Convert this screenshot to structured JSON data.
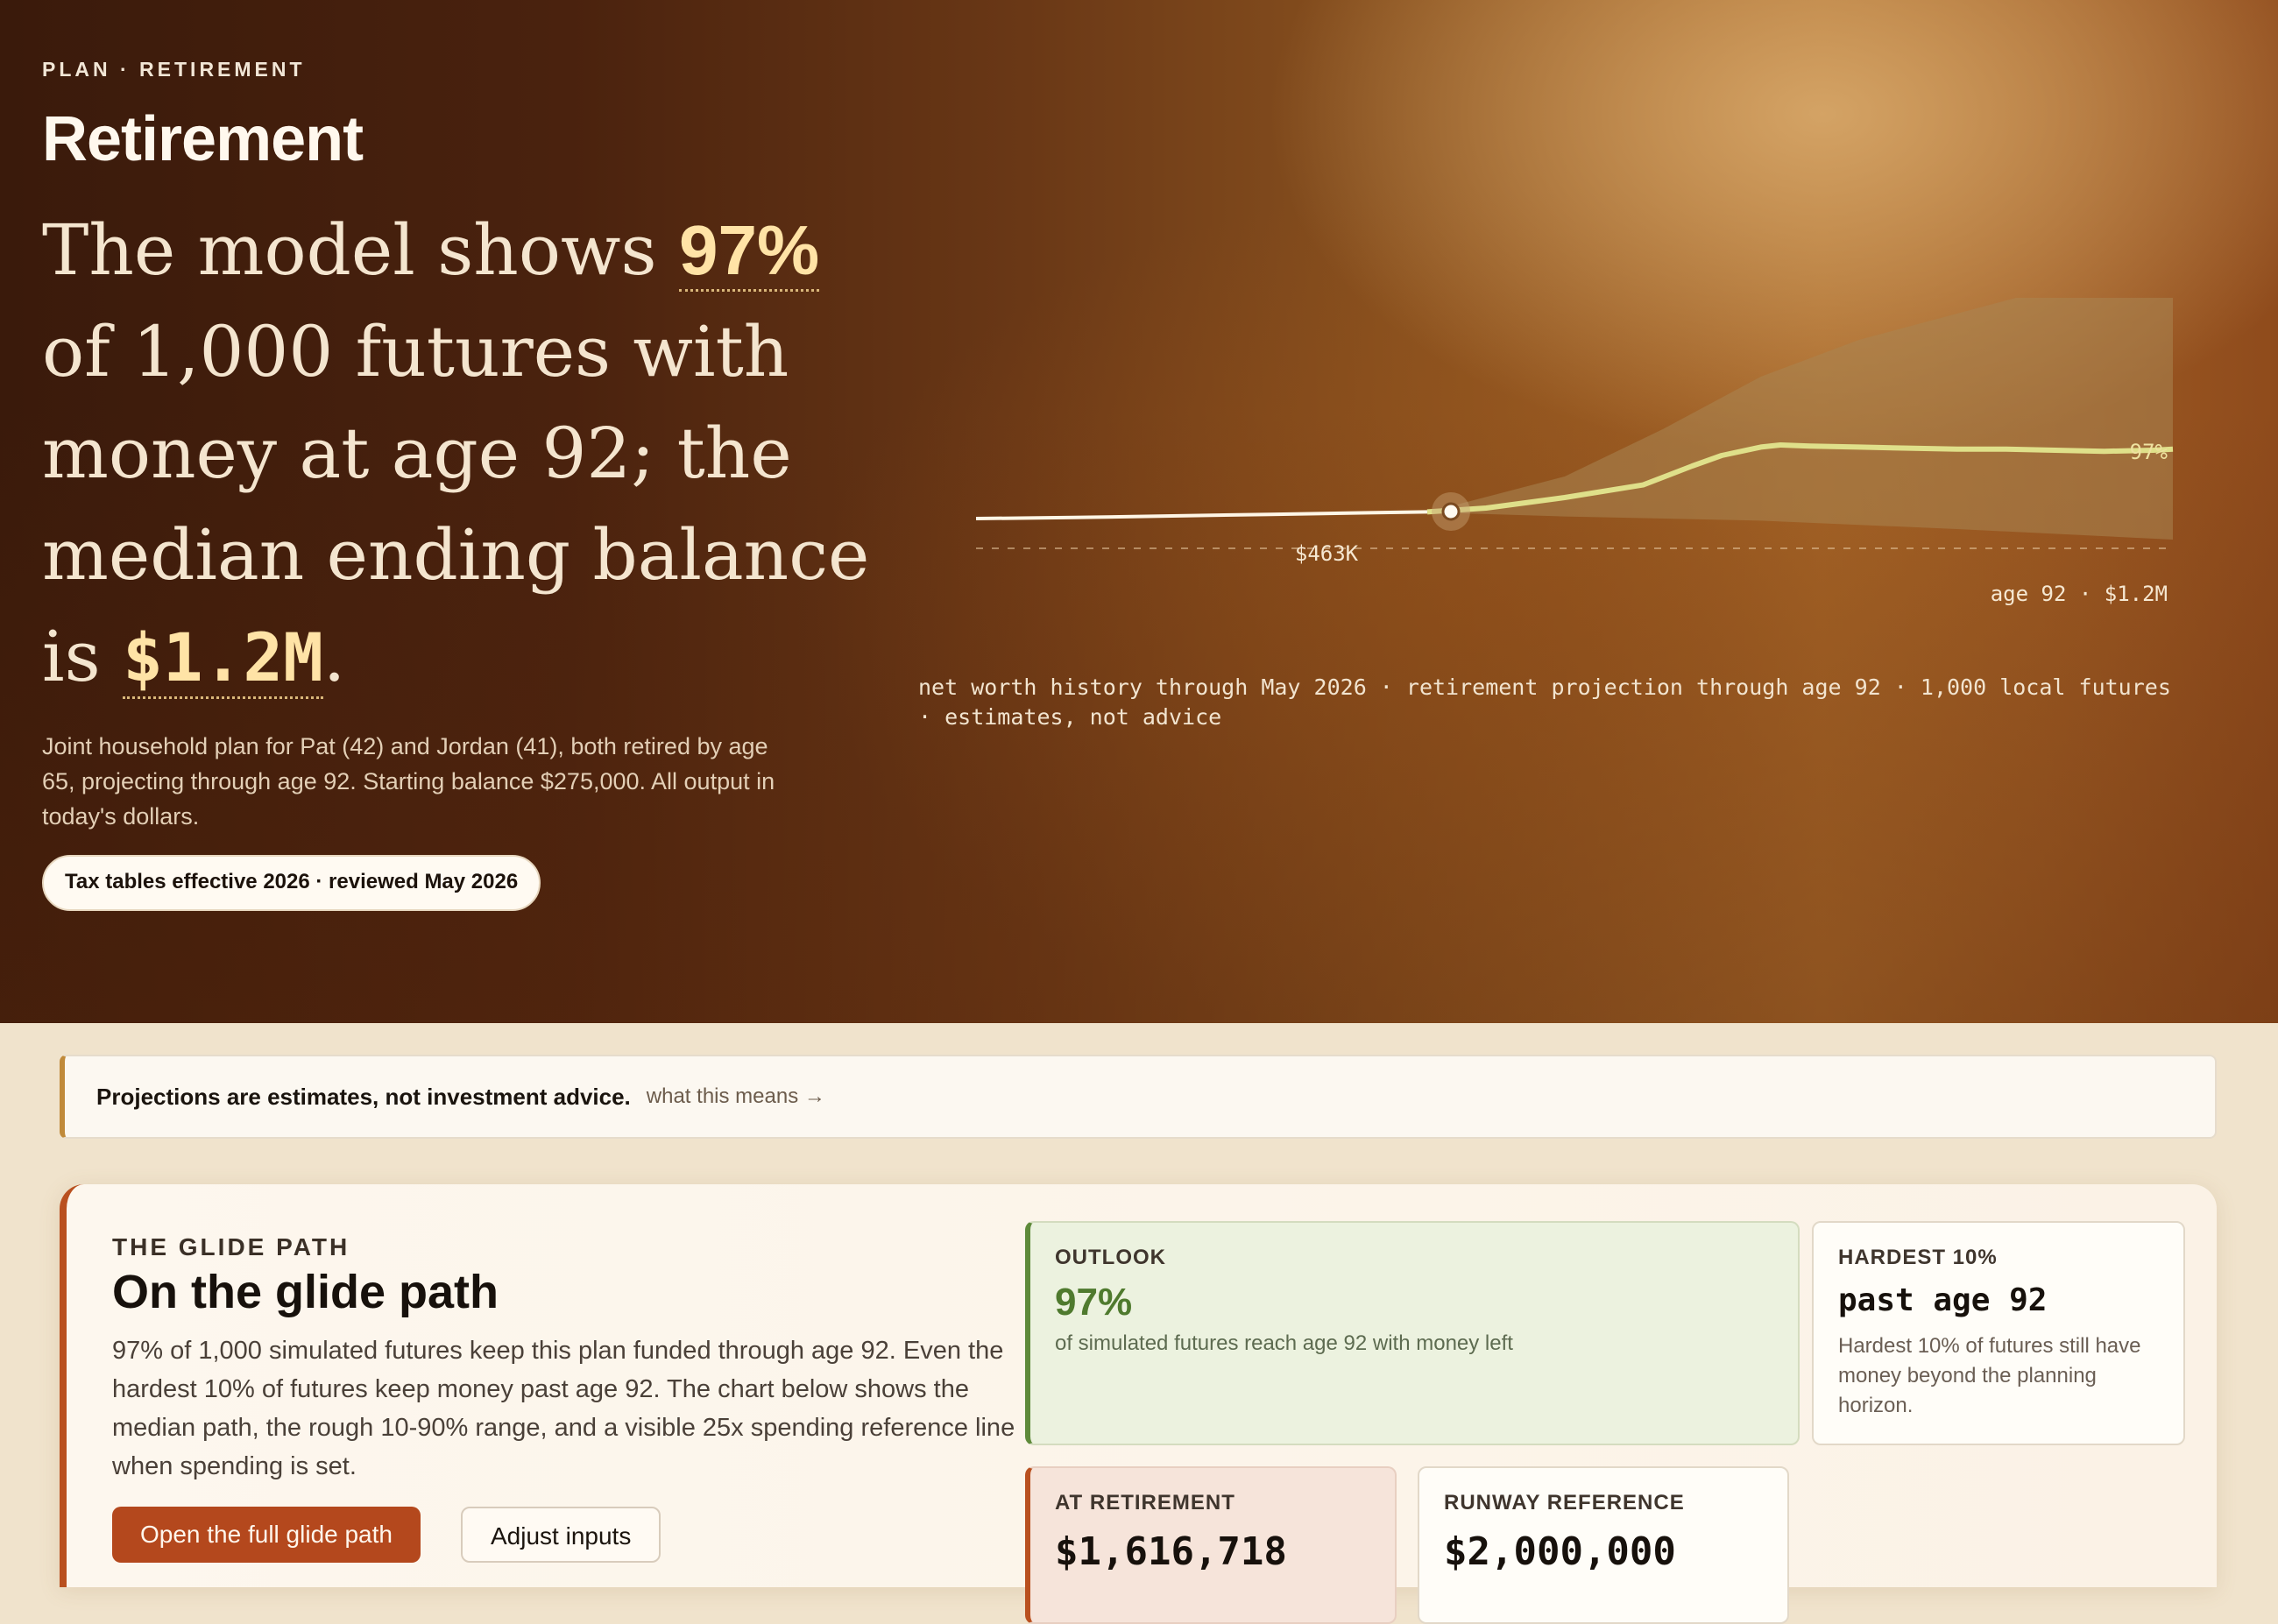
{
  "hero": {
    "eyebrow": "PLAN · RETIREMENT",
    "title": "Retirement",
    "headline": {
      "part1": "The model shows ",
      "success_rate": "97%",
      "part2": " of 1,000 futures with money at age 92; the median ending balance is ",
      "median_balance": "$1.2M",
      "part3": "."
    },
    "subtext": "Joint household plan for Pat (42) and Jordan (41), both retired by age 65, projecting through age 92. Starting balance $275,000. All output in today's dollars.",
    "tax_pill": "Tax tables effective 2026 · reviewed May 2026"
  },
  "chart_data": {
    "type": "line",
    "series": [
      {
        "name": "history",
        "points": [
          [
            0,
            0.4
          ],
          [
            0.1,
            0.41
          ],
          [
            0.2,
            0.425
          ],
          [
            0.3,
            0.44
          ],
          [
            0.4,
            0.455
          ],
          [
            0.46,
            0.463
          ]
        ]
      },
      {
        "name": "median",
        "points": [
          [
            0.46,
            0.463
          ],
          [
            0.52,
            0.5
          ],
          [
            0.6,
            0.6
          ],
          [
            0.68,
            0.72
          ],
          [
            0.73,
            0.9
          ],
          [
            0.76,
            1.0
          ],
          [
            0.8,
            1.08
          ],
          [
            0.82,
            1.1
          ],
          [
            0.85,
            1.09
          ],
          [
            0.9,
            1.08
          ],
          [
            0.95,
            1.07
          ],
          [
            1.0,
            1.06
          ],
          [
            1.05,
            1.06
          ],
          [
            1.1,
            1.05
          ],
          [
            1.15,
            1.04
          ],
          [
            1.2,
            1.05
          ],
          [
            1.22,
            1.06
          ]
        ]
      }
    ],
    "band_low": [
      [
        0.46,
        0.46
      ],
      [
        0.6,
        0.42
      ],
      [
        0.8,
        0.38
      ],
      [
        1.0,
        0.3
      ],
      [
        1.22,
        0.2
      ]
    ],
    "band_high": [
      [
        0.46,
        0.46
      ],
      [
        0.6,
        0.8
      ],
      [
        0.7,
        1.25
      ],
      [
        0.8,
        1.75
      ],
      [
        0.9,
        2.1
      ],
      [
        1.0,
        2.35
      ],
      [
        1.1,
        2.6
      ],
      [
        1.22,
        2.9
      ]
    ],
    "reference_label": "$463K",
    "success_label": "97%",
    "end_label": "age 92 · $1.2M",
    "caption": "net worth history through May 2026 · retirement projection through age 92 · 1,000 local futures · estimates, not advice",
    "colors": {
      "history": "#fff6e6",
      "median": "#dfe08a",
      "band": "#a98552"
    }
  },
  "notice": {
    "strong": "Projections are estimates, not investment advice.",
    "link": "what this means →"
  },
  "glide": {
    "eyebrow": "THE GLIDE PATH",
    "title": "On the glide path",
    "body": "97% of 1,000 simulated futures keep this plan funded through age 92. Even the hardest 10% of futures keep money past age 92. The chart below shows the median path, the rough 10-90% range, and a visible 25x spending reference line when spending is set.",
    "primary_button": "Open the full glide path",
    "secondary_button": "Adjust inputs",
    "outlook": {
      "label": "OUTLOOK",
      "value": "97%",
      "note": "of simulated futures reach age 92 with money left"
    },
    "hardest": {
      "label": "HARDEST 10%",
      "value": "past age 92",
      "note": "Hardest 10% of futures still have money beyond the planning horizon."
    },
    "at_retirement": {
      "label": "AT RETIREMENT",
      "value": "$1,616,718"
    },
    "runway": {
      "label": "RUNWAY REFERENCE",
      "value": "$2,000,000"
    }
  }
}
